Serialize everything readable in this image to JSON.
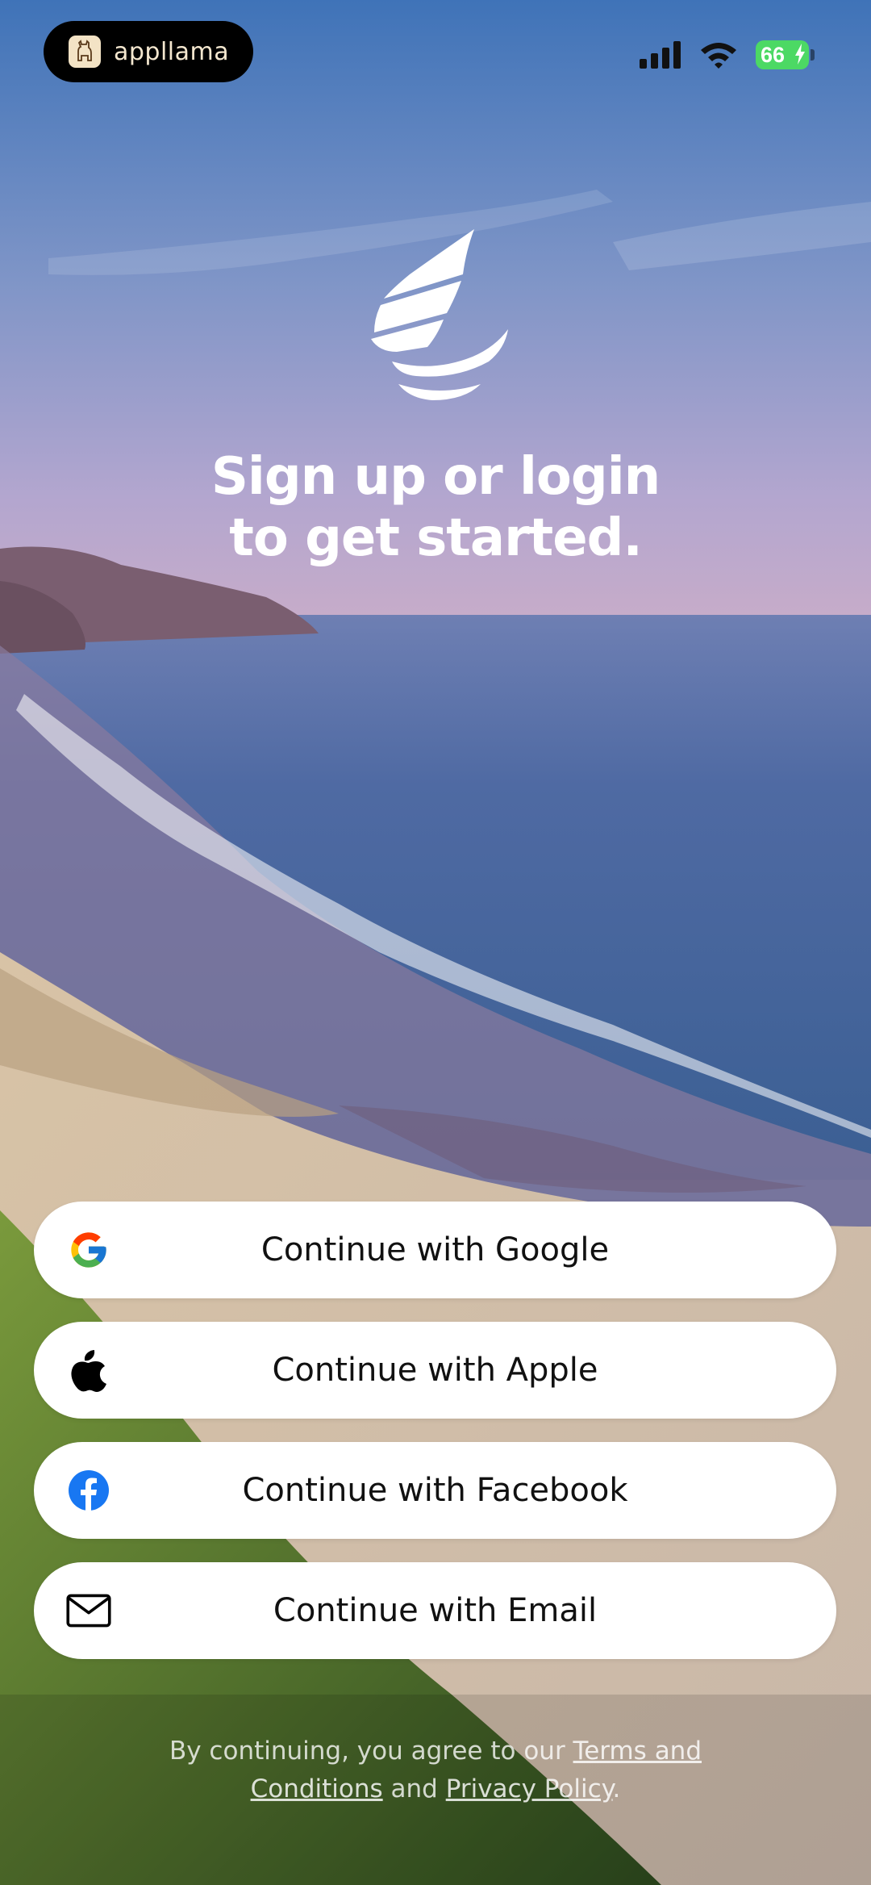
{
  "status_bar": {
    "brand_name": "appllama",
    "battery_level": "66",
    "icons": [
      "signal-icon",
      "wifi-icon",
      "battery-charging-icon"
    ]
  },
  "hero": {
    "logo": "sail-logo",
    "headline_line1": "Sign up or login",
    "headline_line2": "to get started."
  },
  "auth_buttons": {
    "google": {
      "label": "Continue with Google",
      "icon": "google-icon"
    },
    "apple": {
      "label": "Continue with Apple",
      "icon": "apple-icon"
    },
    "facebook": {
      "label": "Continue with Facebook",
      "icon": "facebook-icon",
      "color": "#1877F2"
    },
    "email": {
      "label": "Continue with Email",
      "icon": "mail-icon"
    }
  },
  "legal": {
    "prefix": "By continuing, you agree to our ",
    "terms_link": "Terms and Conditions",
    "middle": " and ",
    "privacy_link": "Privacy Policy",
    "suffix": "."
  },
  "colors": {
    "button_bg": "#FFFFFF",
    "text_primary": "#111111",
    "battery_green": "#4CD964"
  }
}
